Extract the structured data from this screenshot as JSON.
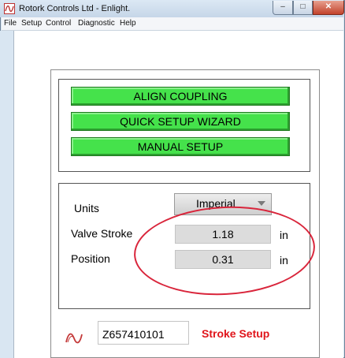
{
  "window": {
    "title": "Rotork Controls Ltd - Enlight.",
    "app_icon": "rotork-logo-icon",
    "controls": {
      "minimize": "–",
      "maximize": "□",
      "close": "✕"
    }
  },
  "menu": {
    "items": [
      "File",
      "Setup",
      "Control",
      "Diagnostic",
      "Help"
    ]
  },
  "actions": {
    "align_coupling": "ALIGN COUPLING",
    "quick_setup": "QUICK SETUP WIZARD",
    "manual_setup": "MANUAL SETUP"
  },
  "settings": {
    "units_label": "Units",
    "units_value": "Imperial",
    "valve_stroke_label": "Valve Stroke",
    "valve_stroke_value": "1.18",
    "valve_stroke_unit": "in",
    "position_label": "Position",
    "position_value": "0.31",
    "position_unit": "in"
  },
  "footer": {
    "logo": "rotork-logo-icon",
    "serial": "Z657410101",
    "status": "Stroke Setup"
  },
  "colors": {
    "button_green": "#45e24b",
    "status_red": "#e0151b",
    "highlight_red": "#d9253b"
  }
}
